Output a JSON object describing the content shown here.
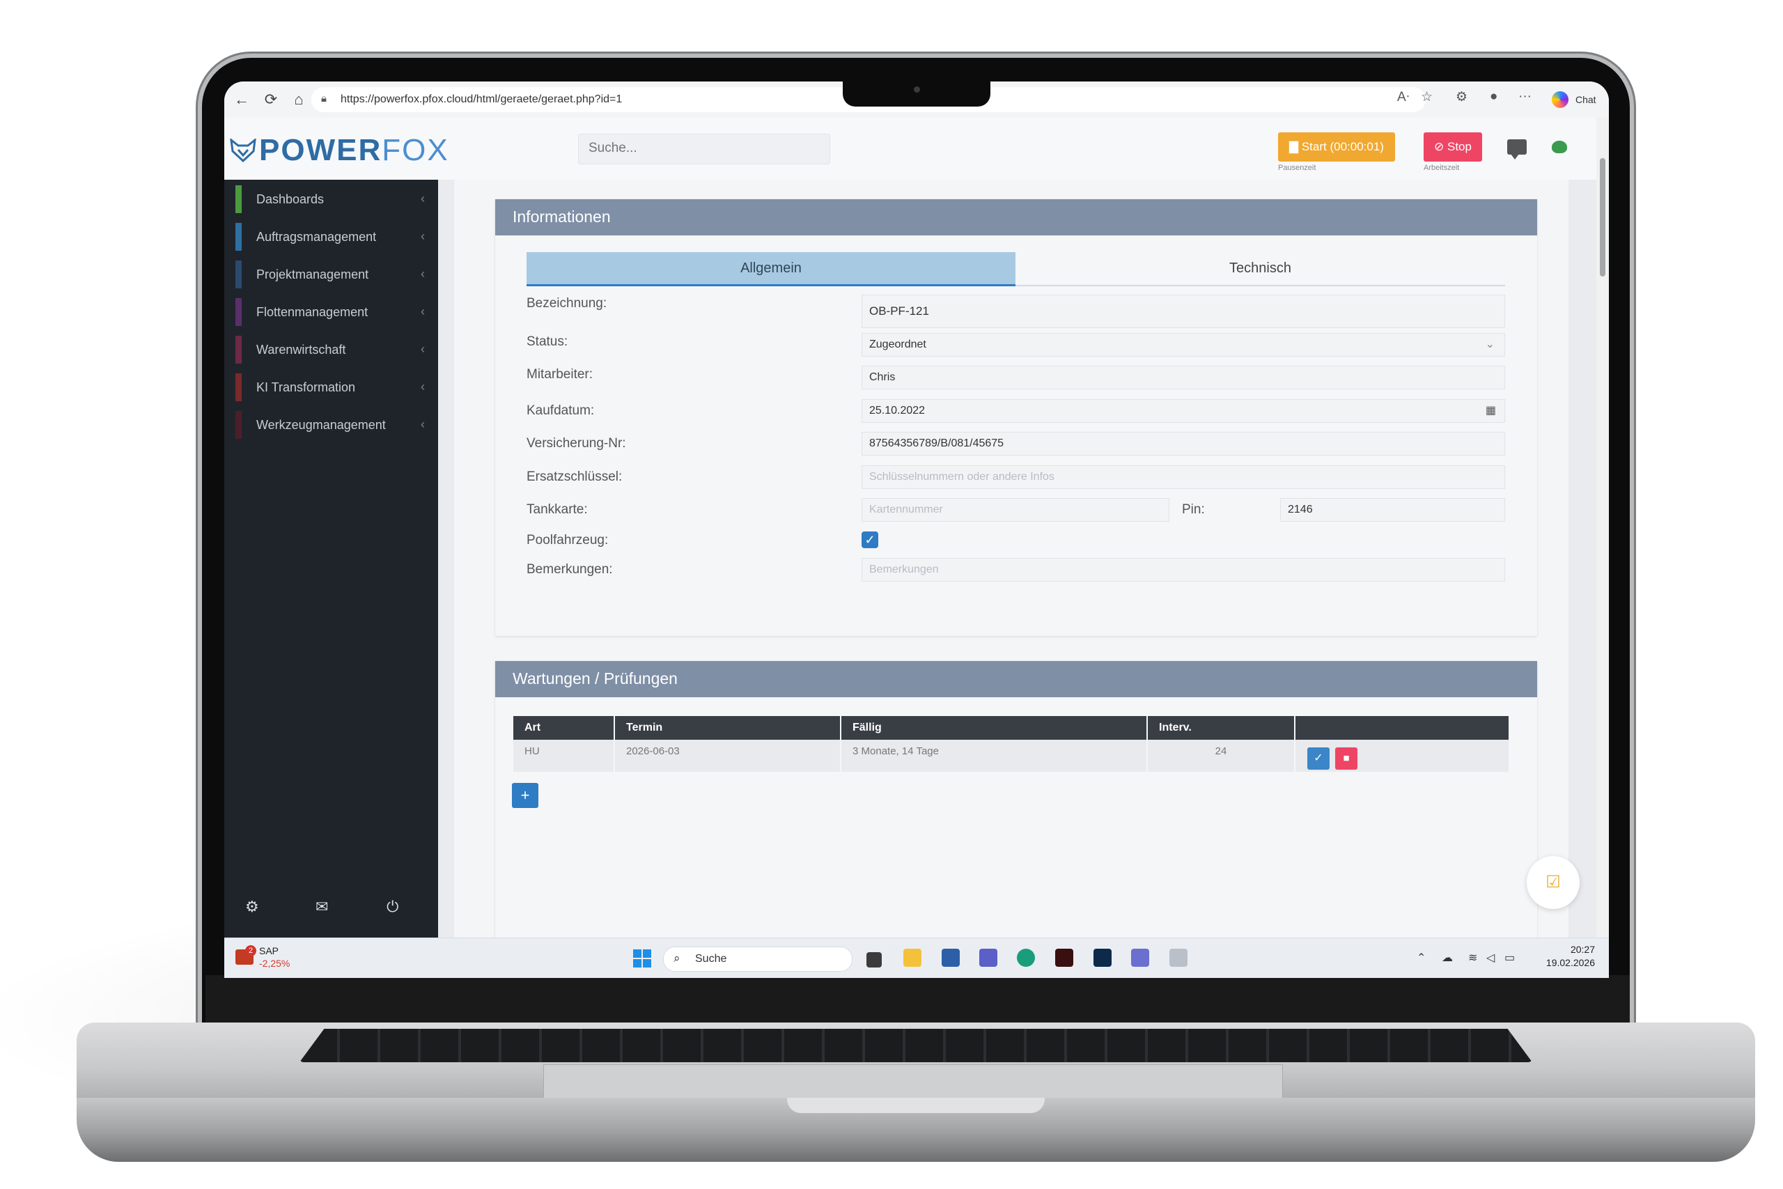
{
  "browser": {
    "url": "https://powerfox.pfox.cloud/html/geraete/geraet.php?id=1",
    "chat_label": "Chat"
  },
  "header": {
    "logo_power": "POWER",
    "logo_fox": "FOX",
    "search_placeholder": "Suche...",
    "start_label": "Start (00:00:01)",
    "start_sublabel": "Pausenzeit",
    "stop_label": "Stop",
    "stop_sublabel": "Arbeitszeit"
  },
  "sidebar": {
    "items": [
      {
        "label": "Dashboards",
        "color": "#4c9a3f"
      },
      {
        "label": "Auftragsmanagement",
        "color": "#2f6fa0"
      },
      {
        "label": "Projektmanagement",
        "color": "#2b4a6d"
      },
      {
        "label": "Flottenmanagement",
        "color": "#5a2f6a"
      },
      {
        "label": "Warenwirtschaft",
        "color": "#6d2a45"
      },
      {
        "label": "KI Transformation",
        "color": "#7a2a2a"
      },
      {
        "label": "Werkzeugmanagement",
        "color": "#4a1f2a"
      }
    ]
  },
  "info": {
    "title": "Informationen",
    "tabs": [
      "Allgemein",
      "Technisch"
    ],
    "labels": {
      "bezeichnung": "Bezeichnung:",
      "status": "Status:",
      "mitarbeiter": "Mitarbeiter:",
      "kaufdatum": "Kaufdatum:",
      "versicherung": "Versicherung-Nr:",
      "ersatzschluessel": "Ersatzschlüssel:",
      "tankkarte": "Tankkarte:",
      "pin": "Pin:",
      "poolfahrzeug": "Poolfahrzeug:",
      "bemerkungen": "Bemerkungen:"
    },
    "values": {
      "bezeichnung": "OB-PF-121",
      "status": "Zugeordnet",
      "mitarbeiter": "Chris",
      "kaufdatum": "25.10.2022",
      "versicherung": "87564356789/B/081/45675",
      "pin": "2146"
    },
    "placeholders": {
      "ersatzschluessel": "Schlüsselnummern oder andere Infos",
      "tankkarte": "Kartennummer",
      "bemerkungen": "Bemerkungen"
    },
    "poolfahrzeug_checked": true
  },
  "maintenance": {
    "title": "Wartungen / Prüfungen",
    "columns": [
      "Art",
      "Termin",
      "Fällig",
      "Interv.",
      ""
    ],
    "rows": [
      {
        "art": "HU",
        "termin": "2026-06-03",
        "faellig": "3 Monate, 14 Tage",
        "interv": "24"
      }
    ],
    "add_label": "+"
  },
  "taskbar": {
    "sap_label": "SAP",
    "sap_change": "-2,25%",
    "sap_badge": "2",
    "search_label": "Suche",
    "time": "20:27",
    "date": "19.02.2026"
  }
}
